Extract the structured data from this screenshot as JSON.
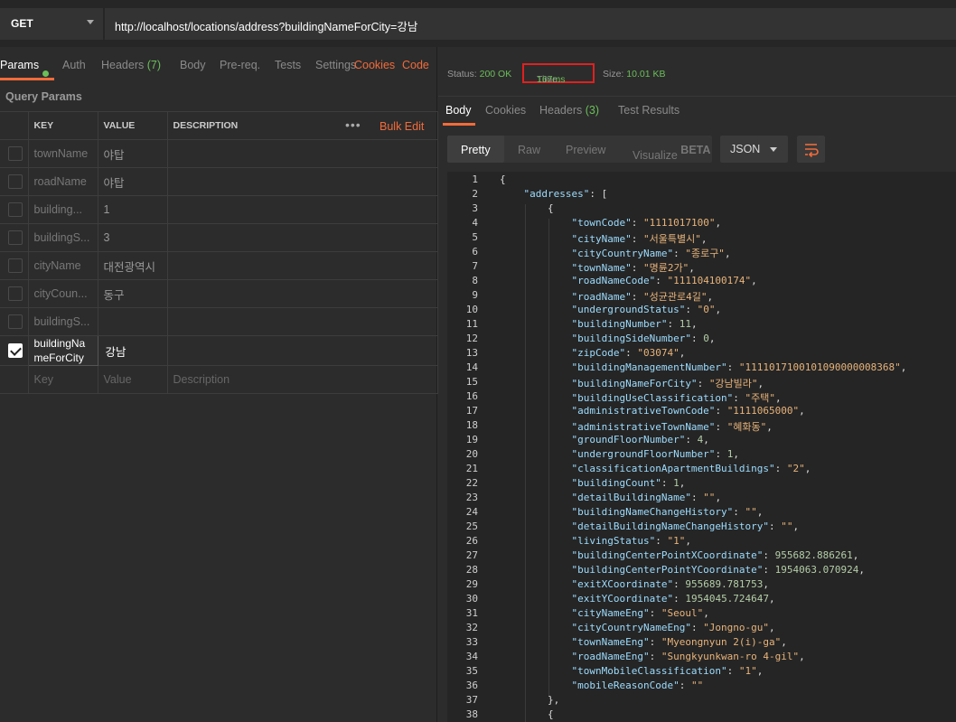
{
  "request": {
    "method": "GET",
    "url": "http://localhost/locations/address?buildingNameForCity=강남"
  },
  "request_tabs": [
    {
      "label": "Params",
      "active": true
    },
    {
      "label": "Auth"
    },
    {
      "label": "Headers",
      "count": "(7)"
    },
    {
      "label": "Body"
    },
    {
      "label": "Pre-req."
    },
    {
      "label": "Tests"
    },
    {
      "label": "Settings"
    }
  ],
  "request_links": {
    "cookies": "Cookies",
    "code": "Code"
  },
  "query_params": {
    "title": "Query Params",
    "headers": {
      "key": "KEY",
      "value": "VALUE",
      "description": "DESCRIPTION",
      "bulk_edit": "Bulk Edit"
    },
    "rows": [
      {
        "key": "townName",
        "value": "야탑",
        "checked": false
      },
      {
        "key": "roadName",
        "value": "야탑",
        "checked": false
      },
      {
        "key": "building...",
        "value": "1",
        "checked": false
      },
      {
        "key": "buildingS...",
        "value": "3",
        "checked": false
      },
      {
        "key": "cityName",
        "value": "대전광역시",
        "checked": false
      },
      {
        "key": "cityCoun...",
        "value": "동구",
        "checked": false
      },
      {
        "key": "buildingS...",
        "value": "",
        "checked": false
      },
      {
        "key": "buildingNameForCity",
        "value": "강남",
        "checked": true
      }
    ],
    "placeholder": {
      "key": "Key",
      "value": "Value",
      "description": "Description"
    }
  },
  "response": {
    "status_label": "Status:",
    "status_value": "200 OK",
    "time_label": "Time:",
    "time_value": "167ms",
    "size_label": "Size:",
    "size_value": "10.01 KB",
    "tabs": [
      {
        "label": "Body",
        "active": true
      },
      {
        "label": "Cookies"
      },
      {
        "label": "Headers",
        "count": "(3)"
      },
      {
        "label": "Test Results"
      }
    ],
    "view_modes": [
      "Pretty",
      "Raw",
      "Preview",
      "Visualize"
    ],
    "beta": "BETA",
    "format": "JSON"
  },
  "code_lines": [
    "{",
    "    \"addresses\": [",
    "        {",
    "            \"townCode\": \"1111017100\",",
    "            \"cityName\": \"서울특별시\",",
    "            \"cityCountryName\": \"종로구\",",
    "            \"townName\": \"명륜2가\",",
    "            \"roadNameCode\": \"111104100174\",",
    "            \"roadName\": \"성균관로4길\",",
    "            \"undergroundStatus\": \"0\",",
    "            \"buildingNumber\": 11,",
    "            \"buildingSideNumber\": 0,",
    "            \"zipCode\": \"03074\",",
    "            \"buildingManagementNumber\": \"1111017100101090000008368\",",
    "            \"buildingNameForCity\": \"강남빌라\",",
    "            \"buildingUseClassification\": \"주택\",",
    "            \"administrativeTownCode\": \"1111065000\",",
    "            \"administrativeTownName\": \"혜화동\",",
    "            \"groundFloorNumber\": 4,",
    "            \"undergroundFloorNumber\": 1,",
    "            \"classificationApartmentBuildings\": \"2\",",
    "            \"buildingCount\": 1,",
    "            \"detailBuildingName\": \"\",",
    "            \"buildingNameChangeHistory\": \"\",",
    "            \"detailBuildingNameChangeHistory\": \"\",",
    "            \"livingStatus\": \"1\",",
    "            \"buildingCenterPointXCoordinate\": 955682.886261,",
    "            \"buildingCenterPointYCoordinate\": 1954063.070924,",
    "            \"exitXCoordinate\": 955689.781753,",
    "            \"exitYCoordinate\": 1954045.724647,",
    "            \"cityNameEng\": \"Seoul\",",
    "            \"cityCountryNameEng\": \"Jongno-gu\",",
    "            \"townNameEng\": \"Myeongnyun 2(i)-ga\",",
    "            \"roadNameEng\": \"Sungkyunkwan-ro 4-gil\",",
    "            \"townMobileClassification\": \"1\",",
    "            \"mobileReasonCode\": \"\"",
    "        },",
    "        {"
  ]
}
